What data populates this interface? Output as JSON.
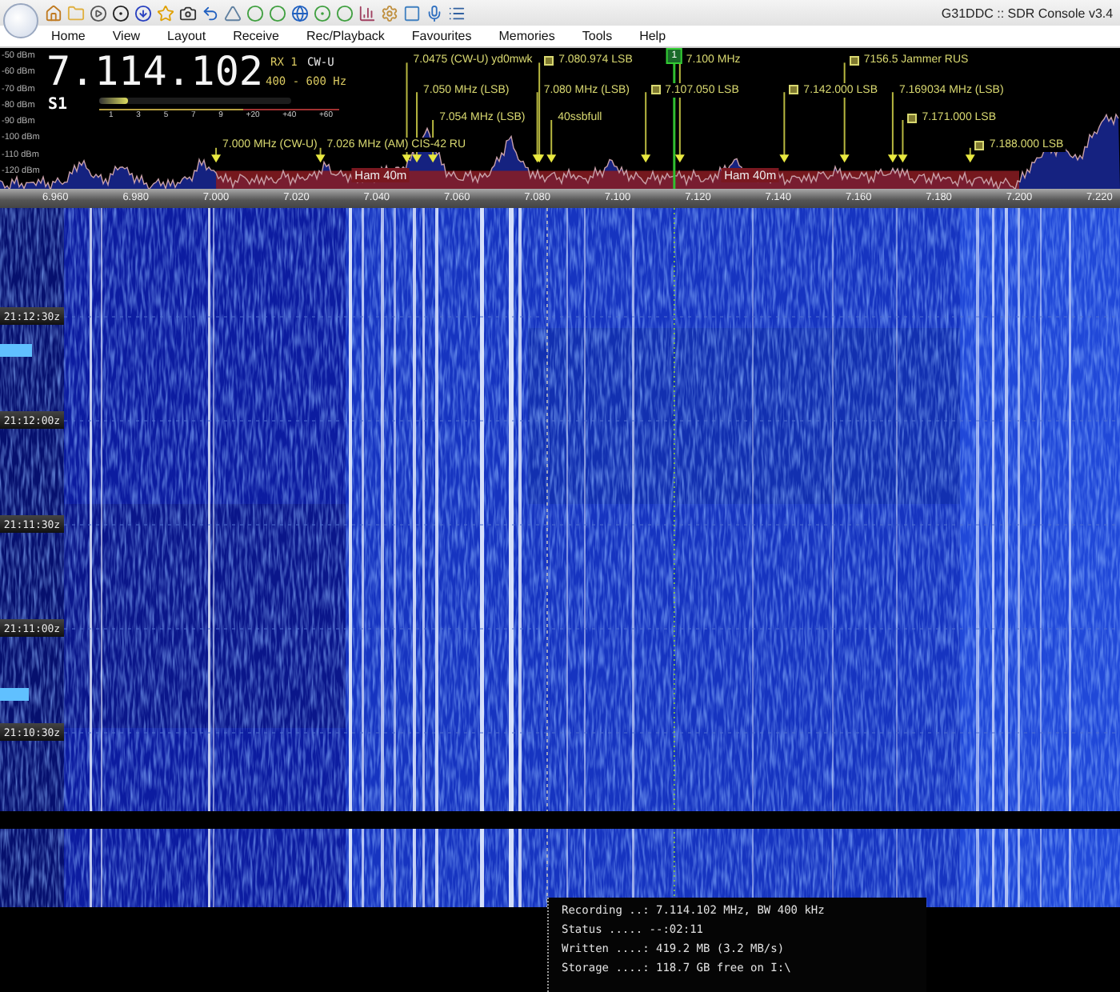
{
  "window": {
    "title": "G31DDC :: SDR Console v3.4"
  },
  "menu": [
    "Home",
    "View",
    "Layout",
    "Receive",
    "Rec/Playback",
    "Favourites",
    "Memories",
    "Tools",
    "Help"
  ],
  "receiver": {
    "frequency": "7.114.102",
    "rx": "RX 1",
    "mode": "CW-U",
    "filter": "400 - 600 Hz",
    "s_reading": "S1",
    "s_meter": {
      "level": 0.15,
      "scale": [
        "1",
        "3",
        "5",
        "7",
        "9",
        "+20",
        "+40",
        "+60"
      ]
    }
  },
  "spectrum": {
    "db_labels": [
      "-50 dBm",
      "-60 dBm",
      "-70 dBm",
      "-80 dBm",
      "-90 dBm",
      "-100 dBm",
      "-110 dBm",
      "-120 dBm"
    ],
    "cursor": "1",
    "band_labels": [
      "Ham 40m",
      "Ham 40m"
    ],
    "markers": [
      {
        "text": "7.0475 (CW-U) yd0mwk",
        "memory": false
      },
      {
        "text": "7.050 MHz (LSB)",
        "memory": false
      },
      {
        "text": "7.054 MHz (LSB)",
        "memory": false
      },
      {
        "text": "7.000 MHz (CW-U)",
        "memory": false
      },
      {
        "text": "7.026 MHz (AM) CIS-42 RU",
        "memory": false
      },
      {
        "text": "7.080.974 LSB",
        "memory": true
      },
      {
        "text": "7.080 MHz (LSB)",
        "memory": false
      },
      {
        "text": "40ssbfull",
        "memory": false
      },
      {
        "text": "7.107.050 LSB",
        "memory": true
      },
      {
        "text": "7.100 MHz",
        "memory": false
      },
      {
        "text": "7.142.000 LSB",
        "memory": true
      },
      {
        "text": "7156.5 Jammer RUS",
        "memory": true
      },
      {
        "text": "7.169034 MHz (LSB)",
        "memory": false
      },
      {
        "text": "7.171.000 LSB",
        "memory": true
      },
      {
        "text": "7.188.000 LSB",
        "memory": true
      }
    ]
  },
  "frequency_axis": [
    "6.960",
    "6.980",
    "7.000",
    "7.020",
    "7.040",
    "7.060",
    "7.080",
    "7.100",
    "7.120",
    "7.140",
    "7.160",
    "7.180",
    "7.200",
    "7.220"
  ],
  "waterfall": {
    "time_labels": [
      "21:12:30z",
      "21:12:00z",
      "21:11:30z",
      "21:11:00z",
      "21:10:30z"
    ]
  },
  "recording": {
    "lines": [
      "Recording ..: 7.114.102 MHz, BW 400 kHz",
      "Status ..... --:02:11",
      "Written ....: 419.2 MB (3.2 MB/s)",
      "Storage ....: 118.7 GB free on I:\\"
    ]
  }
}
